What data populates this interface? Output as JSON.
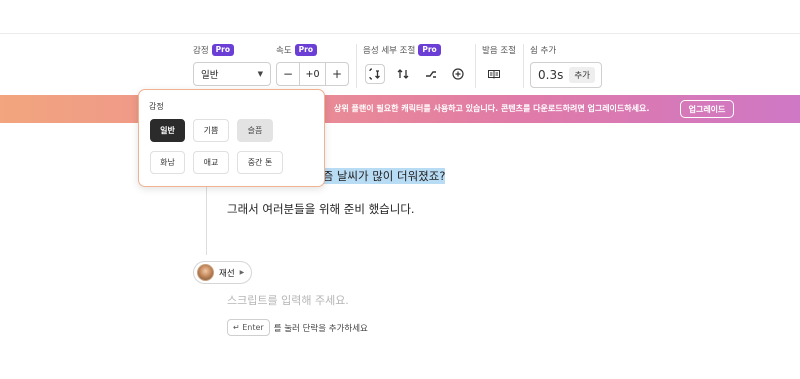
{
  "toolbar": {
    "emotion_label": "감정",
    "pro_badge": "Pro",
    "emotion_value": "일반",
    "speed_label": "속도",
    "speed_minus": "−",
    "speed_value": "+0",
    "speed_plus": "+",
    "voice_detail_label": "음성 세부 조절",
    "pronunciation_label": "발음 조절",
    "pause_label": "쉼 추가",
    "pause_value": "0.3s",
    "pause_add": "추가"
  },
  "banner": {
    "text": "상위 플랜이 필요한 캐릭터를 사용하고 있습니다. 콘텐츠를 다운로드하려면 업그레이드하세요.",
    "button": "업그레이드"
  },
  "popup": {
    "title": "감정",
    "options": [
      "일반",
      "기쁨",
      "슬픔",
      "화남",
      "애교",
      "중간 톤"
    ],
    "selected": "일반"
  },
  "script": {
    "line1": "요즘 날씨가 많이 더워졌죠?",
    "line2": "그래서 여러분들을 위해 준비 했습니다."
  },
  "speaker": {
    "name": "재선"
  },
  "editor": {
    "placeholder": "스크립트를 입력해 주세요.",
    "enter_key": "↵ Enter",
    "enter_hint": "를 눌러 단락을 추가하세요"
  },
  "colors": {
    "pro_badge": "#6b3fd6",
    "popup_border": "#f0b28f",
    "selection": "#b9dcf5",
    "banner_start": "#f2a57e",
    "banner_end": "#cf78c5"
  }
}
